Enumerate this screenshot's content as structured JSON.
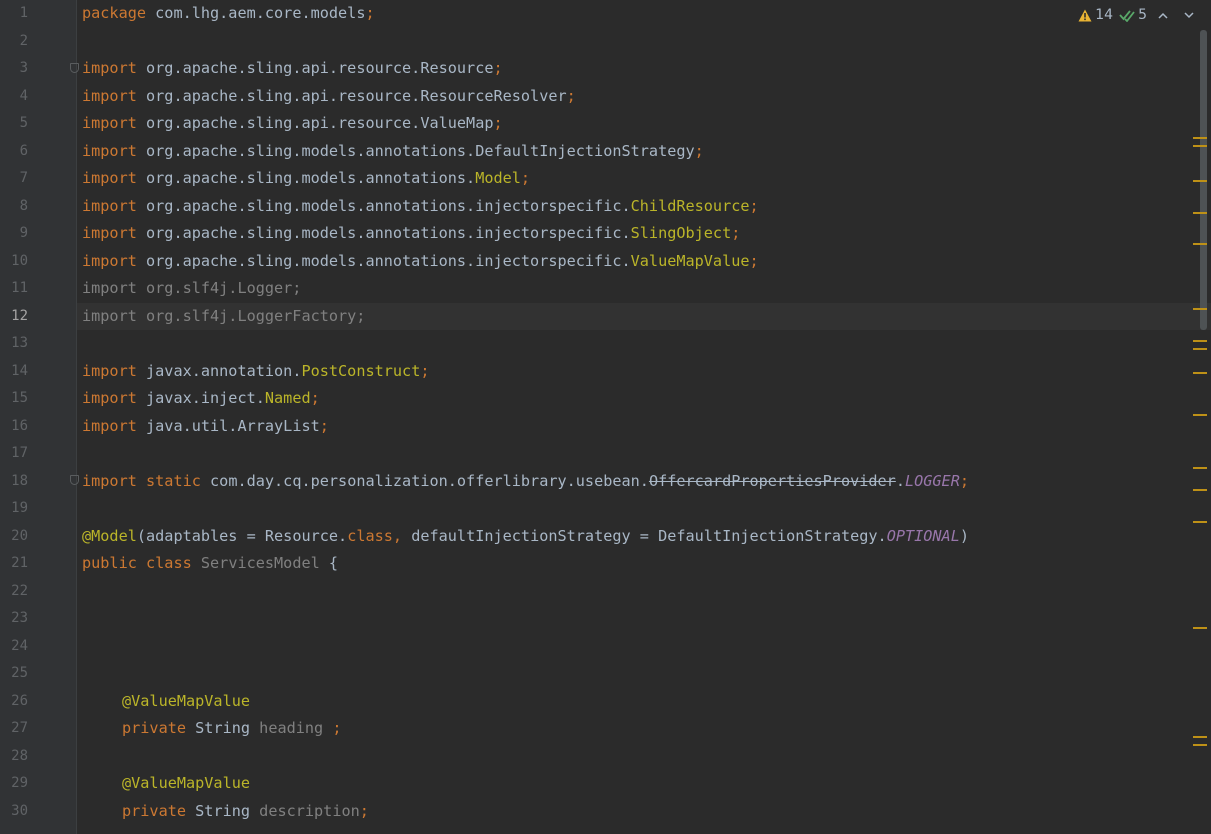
{
  "status": {
    "warnings_count": "14",
    "checks_count": "5",
    "warning_color": "#e8b333",
    "check_color": "#59a869"
  },
  "gutter": {
    "line_numbers": [
      "1",
      "2",
      "3",
      "4",
      "5",
      "6",
      "7",
      "8",
      "9",
      "10",
      "11",
      "12",
      "13",
      "14",
      "15",
      "16",
      "17",
      "18",
      "19",
      "20",
      "21",
      "22",
      "23",
      "24",
      "25",
      "26",
      "27",
      "28",
      "29",
      "30"
    ],
    "current_line": "12"
  },
  "code": {
    "l1_kw": "package",
    "l1_rest": " com.lhg.aem.core.models",
    "l1_semi": ";",
    "import_kw": "import",
    "l3": " org.apache.sling.api.resource.Resource",
    "l4": " org.apache.sling.api.resource.ResourceResolver",
    "l5": " org.apache.sling.api.resource.ValueMap",
    "l6": " org.apache.sling.models.annotations.DefaultInjectionStrategy",
    "l7_pkg": " org.apache.sling.models.annotations.",
    "l7_cls": "Model",
    "l8_pkg": " org.apache.sling.models.annotations.injectorspecific.",
    "l8_cls": "ChildResource",
    "l9_pkg": " org.apache.sling.models.annotations.injectorspecific.",
    "l9_cls": "SlingObject",
    "l10_pkg": " org.apache.sling.models.annotations.injectorspecific.",
    "l10_cls": "ValueMapValue",
    "l11": "import org.slf4j.Logger;",
    "l12": "import org.slf4j.LoggerFactory;",
    "l14_pkg": " javax.annotation.",
    "l14_cls": "PostConstruct",
    "l15_pkg": " javax.inject.",
    "l15_cls": "Named",
    "l16": " java.util.ArrayList",
    "l18_static": " static",
    "l18_pkg": " com.day.cq.personalization.offerlibrary.usebean.",
    "l18_strike": "OffercardPropertiesProvider",
    "l18_dot": ".",
    "l18_field": "LOGGER",
    "l20_ann": "@Model",
    "l20_a": "(adaptables = Resource.",
    "l20_class": "class",
    "l20_comma": ",",
    "l20_b": " defaultInjectionStrategy = DefaultInjectionStrategy.",
    "l20_field": "OPTIONAL",
    "l20_close": ")",
    "l21_public": "public",
    "l21_class": " class",
    "l21_name": " ServicesModel",
    "l21_brace": " {",
    "l26_ann": "@ValueMapValue",
    "private_kw": "private",
    "string_type": " String",
    "l27_name": " heading",
    "l27_semi": " ;",
    "l29_ann": "@ValueMapValue",
    "l30_name": " description",
    "semi": ";"
  }
}
